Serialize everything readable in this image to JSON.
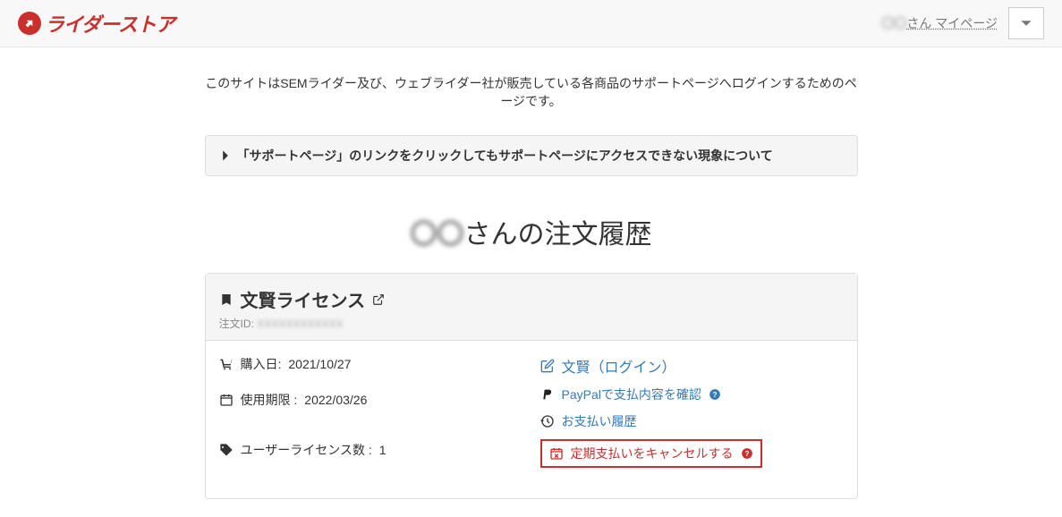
{
  "header": {
    "logo_text": "ライダーストア",
    "user_name": "〇〇",
    "user_suffix": "さん マイページ"
  },
  "intro": "このサイトはSEMライダー及び、ウェブライダー社が販売している各商品のサポートページへログインするためのページです。",
  "notice": {
    "text": "「サポートページ」のリンクをクリックしてもサポートページにアクセスできない現象について"
  },
  "page_title": {
    "name_blur": "〇〇",
    "suffix": "さんの注文履歴"
  },
  "order": {
    "title": "文賢ライセンス",
    "order_id_label": "注文ID:",
    "order_id_value": "XXXXXXXXXXXX",
    "purchase_label": "購入日:",
    "purchase_date": "2021/10/27",
    "expiry_label": "使用期限 :",
    "expiry_date": "2022/03/26",
    "license_label": "ユーザーライセンス数 :",
    "license_count": "1",
    "login_link": "文賢（ログイン）",
    "paypal_link": "PayPalで支払内容を確認",
    "history_link": "お支払い履歴",
    "cancel_link": "定期支払いをキャンセルする"
  }
}
